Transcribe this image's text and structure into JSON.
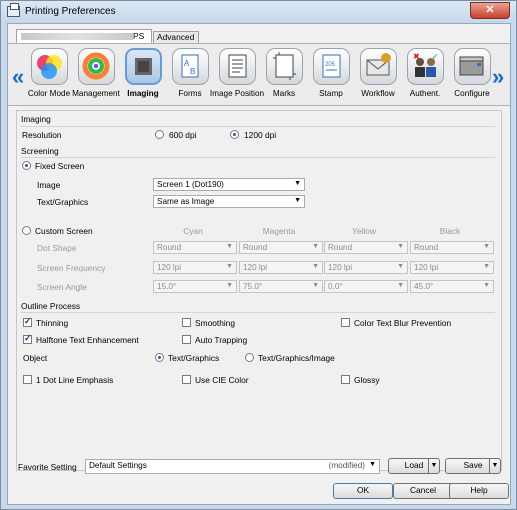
{
  "window": {
    "title": "Printing Preferences",
    "close_glyph": "✕"
  },
  "tabs": {
    "tab1_suffix": "PS",
    "tab2": "Advanced"
  },
  "toolbar": {
    "left_arrow": "«",
    "right_arrow": "»",
    "items": [
      {
        "label": "Color Mode",
        "icon": "color-circles-icon"
      },
      {
        "label": "Management",
        "icon": "color-wheel-icon"
      },
      {
        "label": "Imaging",
        "icon": "imaging-icon"
      },
      {
        "label": "Forms",
        "icon": "forms-icon"
      },
      {
        "label": "Image Position",
        "icon": "image-position-icon"
      },
      {
        "label": "Marks",
        "icon": "marks-icon"
      },
      {
        "label": "Stamp",
        "icon": "stamp-icon"
      },
      {
        "label": "Workflow",
        "icon": "workflow-icon"
      },
      {
        "label": "Authent.",
        "icon": "authentication-icon"
      },
      {
        "label": "Configure",
        "icon": "configure-icon"
      }
    ]
  },
  "imaging": {
    "title": "Imaging",
    "resolution_label": "Resolution",
    "res_600": "600 dpi",
    "res_1200": "1200 dpi",
    "selected": "1200 dpi"
  },
  "screening": {
    "title": "Screening",
    "fixed_label": "Fixed Screen",
    "image_label": "Image",
    "image_value": "Screen 1 (Dot190)",
    "text_label": "Text/Graphics",
    "text_value": "Same as Image",
    "custom_label": "Custom Screen",
    "columns": [
      "Cyan",
      "Magenta",
      "Yellow",
      "Black"
    ],
    "rows": [
      {
        "label": "Dot Shape",
        "values": [
          "Round",
          "Round",
          "Round",
          "Round"
        ]
      },
      {
        "label": "Screen Frequency",
        "values": [
          "120 lpi",
          "120 lpi",
          "120 lpi",
          "120 lpi"
        ]
      },
      {
        "label": "Screen Angle",
        "values": [
          "15.0°",
          "75.0°",
          "0.0°",
          "45.0°"
        ]
      }
    ]
  },
  "outline": {
    "title": "Outline Process",
    "thinning": "Thinning",
    "smoothing": "Smoothing",
    "blur": "Color Text Blur Prevention",
    "halftone": "Halftone Text Enhancement",
    "auto_trapping": "Auto Trapping",
    "object_label": "Object",
    "obj_text": "Text/Graphics",
    "obj_text_image": "Text/Graphics/Image"
  },
  "options": {
    "one_dot": "1 Dot Line Emphasis",
    "cie": "Use CIE Color",
    "glossy": "Glossy"
  },
  "favorite": {
    "label": "Favorite Setting",
    "value": "Default Settings",
    "modified": "(modified)",
    "load": "Load",
    "save": "Save"
  },
  "footer": {
    "ok": "OK",
    "cancel": "Cancel",
    "help": "Help"
  }
}
